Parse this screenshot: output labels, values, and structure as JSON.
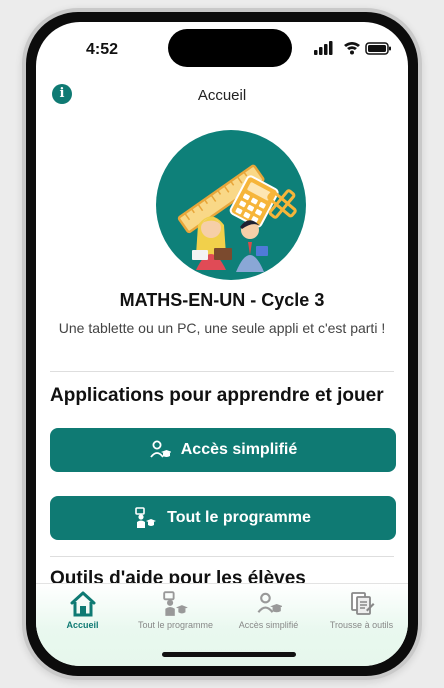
{
  "status_bar": {
    "time": "4:52"
  },
  "header": {
    "title": "Accueil",
    "info_icon": "info-icon"
  },
  "app": {
    "title": "MATHS-EN-UN - Cycle 3",
    "subtitle": "Une tablette ou un PC, une seule appli et c'est parti !"
  },
  "sections": {
    "apps_heading": "Applications pour apprendre et jouer",
    "tools_heading": "Outils d'aide pour les élèves"
  },
  "buttons": {
    "simplified": {
      "label": "Accès simplifié",
      "icon": "student-icon"
    },
    "full_program": {
      "label": "Tout le programme",
      "icon": "student-board-icon"
    }
  },
  "tabs": [
    {
      "label": "Accueil",
      "icon": "home-icon",
      "active": true
    },
    {
      "label": "Tout le programme",
      "icon": "student-board-icon",
      "active": false
    },
    {
      "label": "Accès simplifié",
      "icon": "student-icon",
      "active": false
    },
    {
      "label": "Trousse à outils",
      "icon": "documents-icon",
      "active": false
    }
  ],
  "colors": {
    "accent": "#0f7a73",
    "logo_bg": "#0e8079",
    "tab_inactive": "#888888"
  }
}
